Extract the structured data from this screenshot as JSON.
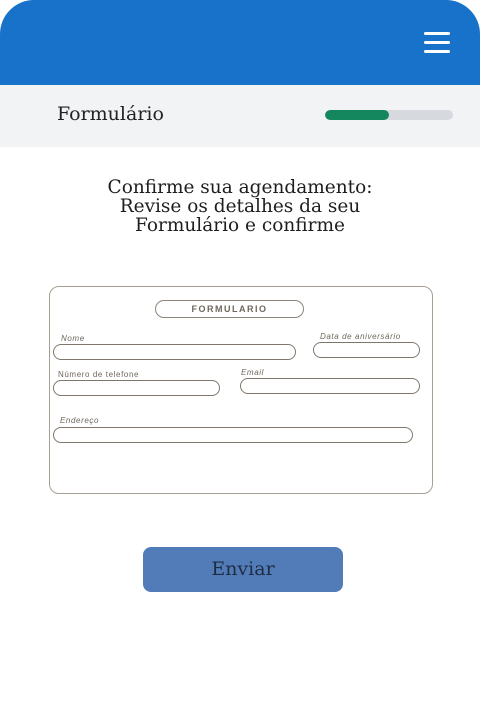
{
  "header": {
    "menu_icon": "hamburger-menu-icon",
    "colors": {
      "brand": "#1872c9"
    }
  },
  "subheader": {
    "title": "Formulário",
    "progress": 0.5,
    "colors": {
      "progress_fill": "#14875f",
      "progress_track": "#d6dadf"
    }
  },
  "heading": {
    "lines": [
      "Confirme sua agendamento:",
      "Revise os detalhes da seu",
      "Formulário e confirme"
    ]
  },
  "form": {
    "title": "FORMULARIO",
    "fields": {
      "nome": {
        "label": "Nome",
        "value": ""
      },
      "data_aniversario": {
        "label": "Data de aniversário",
        "value": ""
      },
      "telefone": {
        "label": "Número de telefone",
        "value": ""
      },
      "email": {
        "label": "Email",
        "value": ""
      },
      "endereco": {
        "label": "Endereço",
        "value": ""
      }
    }
  },
  "actions": {
    "submit_label": "Enviar",
    "colors": {
      "submit_bg": "#527cb7"
    }
  }
}
